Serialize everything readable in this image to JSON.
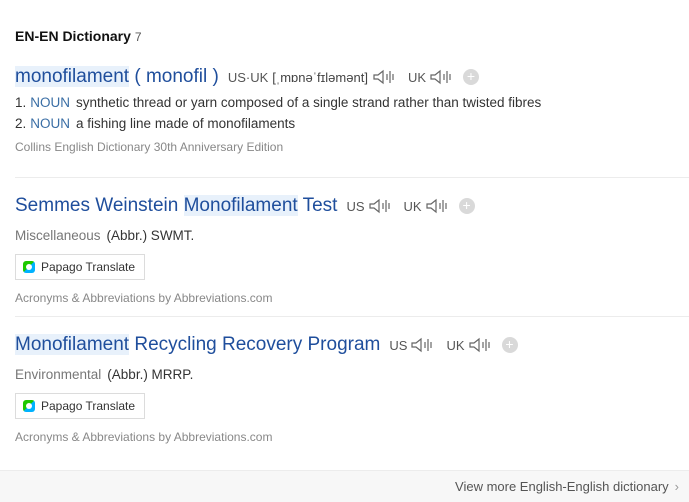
{
  "section": {
    "title": "EN-EN Dictionary",
    "count": "7"
  },
  "entries": [
    {
      "headword": "monofilament",
      "headword_rest": " ( monofil )",
      "pron_us_uk_label": "US·UK",
      "ipa": "[ˌmɒnəˈfɪləmənt]",
      "uk_label": "UK",
      "meanings": [
        {
          "num": "1.",
          "pos": "NOUN",
          "text": "synthetic thread or yarn composed of a single strand rather than twisted fibres"
        },
        {
          "num": "2.",
          "pos": "NOUN",
          "text": "a fishing line made of monofilaments"
        }
      ],
      "source": "Collins English Dictionary 30th Anniversary Edition"
    },
    {
      "headword_pre": "Semmes Weinstein ",
      "headword_hl": "Monofilament",
      "headword_post": " Test",
      "us_label": "US",
      "uk_label": "UK",
      "category": "Miscellaneous",
      "abbr": "(Abbr.) SWMT.",
      "translate_label": "Papago Translate",
      "source": "Acronyms & Abbreviations by Abbreviations.com"
    },
    {
      "headword_hl": "Monofilament",
      "headword_post": " Recycling Recovery Program",
      "us_label": "US",
      "uk_label": "UK",
      "category": "Environmental",
      "abbr": "(Abbr.) MRRP.",
      "translate_label": "Papago Translate",
      "source": "Acronyms & Abbreviations by Abbreviations.com"
    }
  ],
  "footer": {
    "more_label": "View more English-English dictionary",
    "chevron": "›"
  },
  "icons": {
    "speaker": "speaker-icon",
    "plus": "plus-icon",
    "papago": "papago-icon",
    "chevron": "chevron-right-icon"
  },
  "colors": {
    "headword": "#1f4e9c",
    "highlight": "#e8f1fb",
    "pos": "#3a6ea5",
    "source": "#888888"
  }
}
